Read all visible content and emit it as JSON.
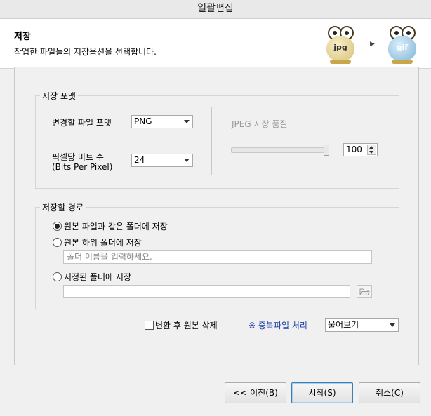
{
  "window": {
    "title": "일괄편집"
  },
  "header": {
    "title": "저장",
    "subtitle": "작업한 파일들의 저장옵션을 선택합니다.",
    "from_label": "jpg",
    "to_label": "gif"
  },
  "save_format": {
    "group_title": "저장 포맷",
    "format_label": "변경할 파일 포맷",
    "format_value": "PNG",
    "bpp_label_line1": "픽셀당 비트 수",
    "bpp_label_line2": "(Bits Per Pixel)",
    "bpp_value": "24",
    "jpeg_quality_label": "JPEG 저장 품질",
    "jpeg_quality_value": "100",
    "jpeg_quality_fraction": 1.0
  },
  "save_path": {
    "group_title": "저장할 경로",
    "option_same_folder": "원본 파일과 같은 폴더에 저장",
    "option_subfolder": "원본 하위 폴더에 저장",
    "subfolder_placeholder": "폴더 이름을 입력하세요.",
    "option_custom_folder": "지정된 폴더에 저장",
    "custom_folder_value": "",
    "selected_option": "same_folder"
  },
  "options": {
    "delete_original_label": "변환 후 원본 삭제",
    "delete_original_checked": false,
    "duplicate_link": "※ 중복파일 처리",
    "duplicate_value": "물어보기"
  },
  "footer": {
    "prev_label": "<< 이전(B)",
    "start_label": "시작(S)",
    "cancel_label": "취소(C)"
  }
}
